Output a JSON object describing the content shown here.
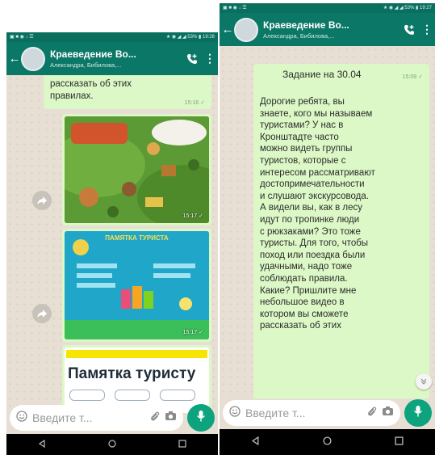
{
  "left": {
    "status_left": "▣ ■ ◉ ↓ ☰",
    "status_right": "★ ◉ ◢ ◢ 53% ▮ 19:26",
    "chat_title": "Краеведение Во...",
    "chat_subtitle": "Александра, Бибилова,...",
    "partial_message": "рассказать об этих\nправилах.",
    "partial_time": "15:16",
    "images": [
      {
        "time": "15:17"
      },
      {
        "time": "15:17",
        "banner": "ПАМЯТКА ТУРИСТА"
      },
      {
        "heading": "Памятка туристу"
      }
    ],
    "input_placeholder": "Введите т..."
  },
  "right": {
    "status_left": "▣ ■ ◉ ↓ ☰",
    "status_right": "★ ◉ ◢ ◢ 53% ▮ 19:27",
    "chat_title": "Краеведение Во...",
    "chat_subtitle": "Александра, Бибилова,...",
    "task_title": "Задание на 30.04",
    "task_time": "15:09",
    "message": "Дорогие ребята, вы\nзнаете, кого мы называем\nтуристами? У нас в\nКронштадте часто\nможно видеть группы\nтуристов, которые с\nинтересом рассматривают\nдостопримечательности\nи слушают экскурсовода.\nА видели вы, как в лесу\nидут по тропинке люди\nс рюкзаками? Это тоже\nтуристы. Для того, чтобы\nпоход или поездка были\nудачными, надо тоже\nсоблюдать правила.\nКакие? Пришлите мне\nнебольшое видео в\nкотором вы сможете\nрассказать об этих",
    "input_placeholder": "Введите т..."
  },
  "colors": {
    "header": "#0b7766",
    "bubble_out": "#dcf8c6",
    "chat_bg": "#e8dfd4",
    "accent": "#0da37f"
  },
  "icons": [
    "back-arrow-icon",
    "avatar",
    "add-call-icon",
    "menu-dots-icon",
    "forward-icon",
    "emoji-icon",
    "attach-icon",
    "camera-icon",
    "mic-icon",
    "scroll-down-icon",
    "nav-back-icon",
    "nav-home-icon",
    "nav-recents-icon",
    "double-check-icon"
  ]
}
